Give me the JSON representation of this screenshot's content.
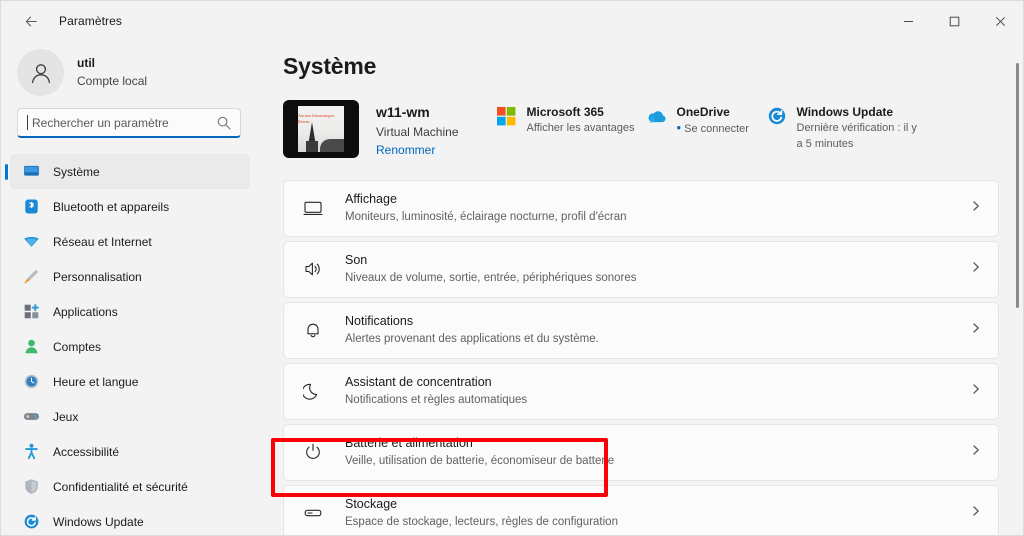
{
  "window": {
    "title": "Paramètres",
    "back_icon": "back-arrow-icon",
    "minimize_label": "—",
    "maximize_label": "□",
    "close_label": "✕"
  },
  "sidebar": {
    "account": {
      "name": "util",
      "subtitle": "Compte local",
      "avatar_icon": "person-icon"
    },
    "search": {
      "placeholder": "Rechercher un paramètre",
      "icon": "search-icon",
      "focused": true
    },
    "items": [
      {
        "label": "Système",
        "icon": "monitor-icon",
        "selected": true
      },
      {
        "label": "Bluetooth et appareils",
        "icon": "bluetooth-icon",
        "selected": false
      },
      {
        "label": "Réseau et Internet",
        "icon": "wifi-icon",
        "selected": false
      },
      {
        "label": "Personnalisation",
        "icon": "paintbrush-icon",
        "selected": false
      },
      {
        "label": "Applications",
        "icon": "apps-icon",
        "selected": false
      },
      {
        "label": "Comptes",
        "icon": "account-icon",
        "selected": false
      },
      {
        "label": "Heure et langue",
        "icon": "clock-icon",
        "selected": false
      },
      {
        "label": "Jeux",
        "icon": "gamepad-icon",
        "selected": false
      },
      {
        "label": "Accessibilité",
        "icon": "accessibility-icon",
        "selected": false
      },
      {
        "label": "Confidentialité et sécurité",
        "icon": "shield-icon",
        "selected": false
      },
      {
        "label": "Windows Update",
        "icon": "update-icon",
        "selected": false
      }
    ]
  },
  "main": {
    "page_title": "Système",
    "device": {
      "name": "w11-wm",
      "type": "Virtual Machine",
      "rename_link": "Renommer",
      "thumbnail_text": "Anciens Informatiques Réseau"
    },
    "quick_links": [
      {
        "title": "Microsoft 365",
        "subtitle": "Afficher les avantages",
        "icon": "microsoft-logo-icon"
      },
      {
        "title": "OneDrive",
        "subtitle": "Se connecter",
        "icon": "onedrive-cloud-icon",
        "bullet": "•"
      },
      {
        "title": "Windows Update",
        "subtitle": "Dernière vérification : il y a 5 minutes",
        "icon": "windows-update-icon"
      }
    ],
    "settings": [
      {
        "title": "Affichage",
        "subtitle": "Moniteurs, luminosité, éclairage nocturne, profil d'écran",
        "icon": "display-icon",
        "highlighted": false
      },
      {
        "title": "Son",
        "subtitle": "Niveaux de volume, sortie, entrée, périphériques sonores",
        "icon": "sound-icon",
        "highlighted": false
      },
      {
        "title": "Notifications",
        "subtitle": "Alertes provenant des applications et du système.",
        "icon": "bell-icon",
        "highlighted": false
      },
      {
        "title": "Assistant de concentration",
        "subtitle": "Notifications et règles automatiques",
        "icon": "moon-icon",
        "highlighted": false
      },
      {
        "title": "Batterie et alimentation",
        "subtitle": "Veille, utilisation de batterie, économiseur de batterie",
        "icon": "power-icon",
        "highlighted": true
      },
      {
        "title": "Stockage",
        "subtitle": "Espace de stockage, lecteurs, règles de configuration",
        "icon": "storage-icon",
        "highlighted": false
      }
    ]
  },
  "annotation": {
    "color": "#fb0007",
    "target": "Batterie et alimentation"
  }
}
